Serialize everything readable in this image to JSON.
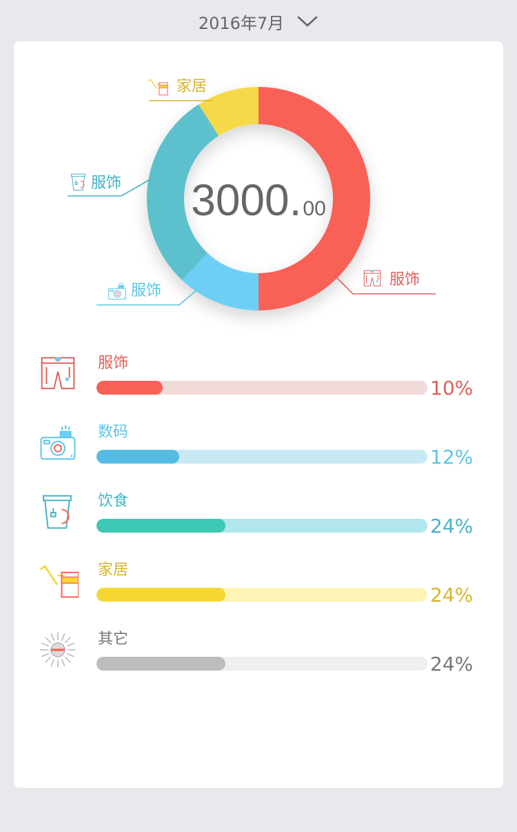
{
  "header": {
    "month_label": "2016年7月"
  },
  "chart_data": {
    "type": "pie",
    "center_value_main": "3000.",
    "center_value_cents": "00",
    "slices": [
      {
        "label": "服饰",
        "value": 50,
        "color": "#f96056",
        "icon": "shorts-icon"
      },
      {
        "label": "服饰",
        "value": 12,
        "color": "#6ecff5",
        "icon": "camera-icon"
      },
      {
        "label": "服饰",
        "value": 29,
        "color": "#5bc1cd",
        "icon": "cup-icon"
      },
      {
        "label": "家居",
        "value": 9,
        "color": "#f6d94a",
        "icon": "watering-can-icon"
      }
    ]
  },
  "categories": [
    {
      "name": "服饰",
      "percent_label": "10%",
      "value": 20,
      "icon": "shorts-icon",
      "text_color": "#e0605a",
      "fill_color": "#f96056",
      "track_color": "#f1dada"
    },
    {
      "name": "数码",
      "percent_label": "12%",
      "value": 25,
      "icon": "camera-icon",
      "text_color": "#5cc5e6",
      "fill_color": "#56bbe5",
      "track_color": "#c8e8f4"
    },
    {
      "name": "饮食",
      "percent_label": "24%",
      "value": 39,
      "icon": "cup-icon",
      "text_color": "#44b3c6",
      "fill_color": "#3ec8b6",
      "track_color": "#b1e6ec"
    },
    {
      "name": "家居",
      "percent_label": "24%",
      "value": 39,
      "icon": "watering-can-icon",
      "text_color": "#d6b62e",
      "fill_color": "#f5d733",
      "track_color": "#fff3b5"
    },
    {
      "name": "其它",
      "percent_label": "24%",
      "value": 39,
      "icon": "sun-icon",
      "text_color": "#777777",
      "fill_color": "#bdbdbd",
      "track_color": "#efefef"
    }
  ]
}
